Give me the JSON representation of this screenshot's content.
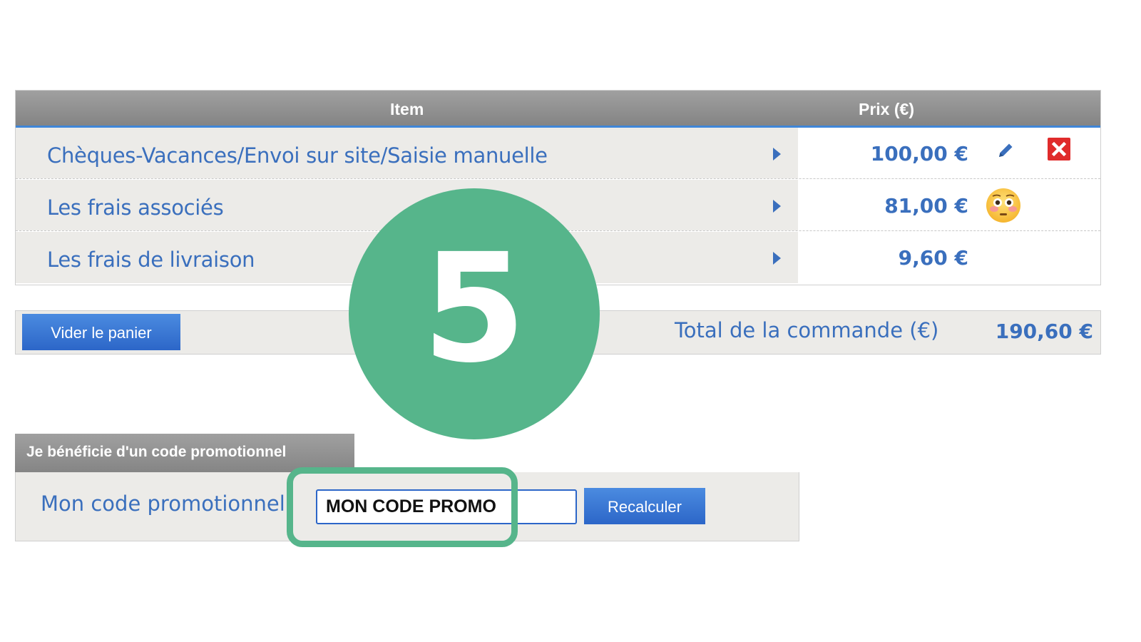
{
  "cart": {
    "header": {
      "item": "Item",
      "price": "Prix (€)"
    },
    "rows": [
      {
        "label": "Chèques-Vacances/Envoi sur site/Saisie manuelle",
        "price": "100,00 €"
      },
      {
        "label": "Les frais associés",
        "price": "81,00 €"
      },
      {
        "label": "Les frais de livraison",
        "price": "9,60 €"
      }
    ]
  },
  "total": {
    "empty_cart_label": "Vider le panier",
    "label": "Total de la commande (€)",
    "value": "190,60 €"
  },
  "promo": {
    "tab_title": "Je bénéficie d'un code promotionnel",
    "label": "Mon code promotionnel",
    "input_value": "MON CODE PROMO",
    "recalc_label": "Recalculer"
  },
  "overlay": {
    "step_number": "5"
  },
  "icons": {
    "row_arrow": "play-arrow-icon",
    "edit": "pencil-icon",
    "delete": "close-icon",
    "emoji": "flushed-face-emoji-icon"
  },
  "colors": {
    "accent_blue": "#3a6fbd",
    "button_blue": "#2c66c8",
    "header_gray": "#8e8e8e",
    "row_bg": "#ecebe8",
    "delete_red": "#e02b2b",
    "step_green": "#56b58b"
  }
}
